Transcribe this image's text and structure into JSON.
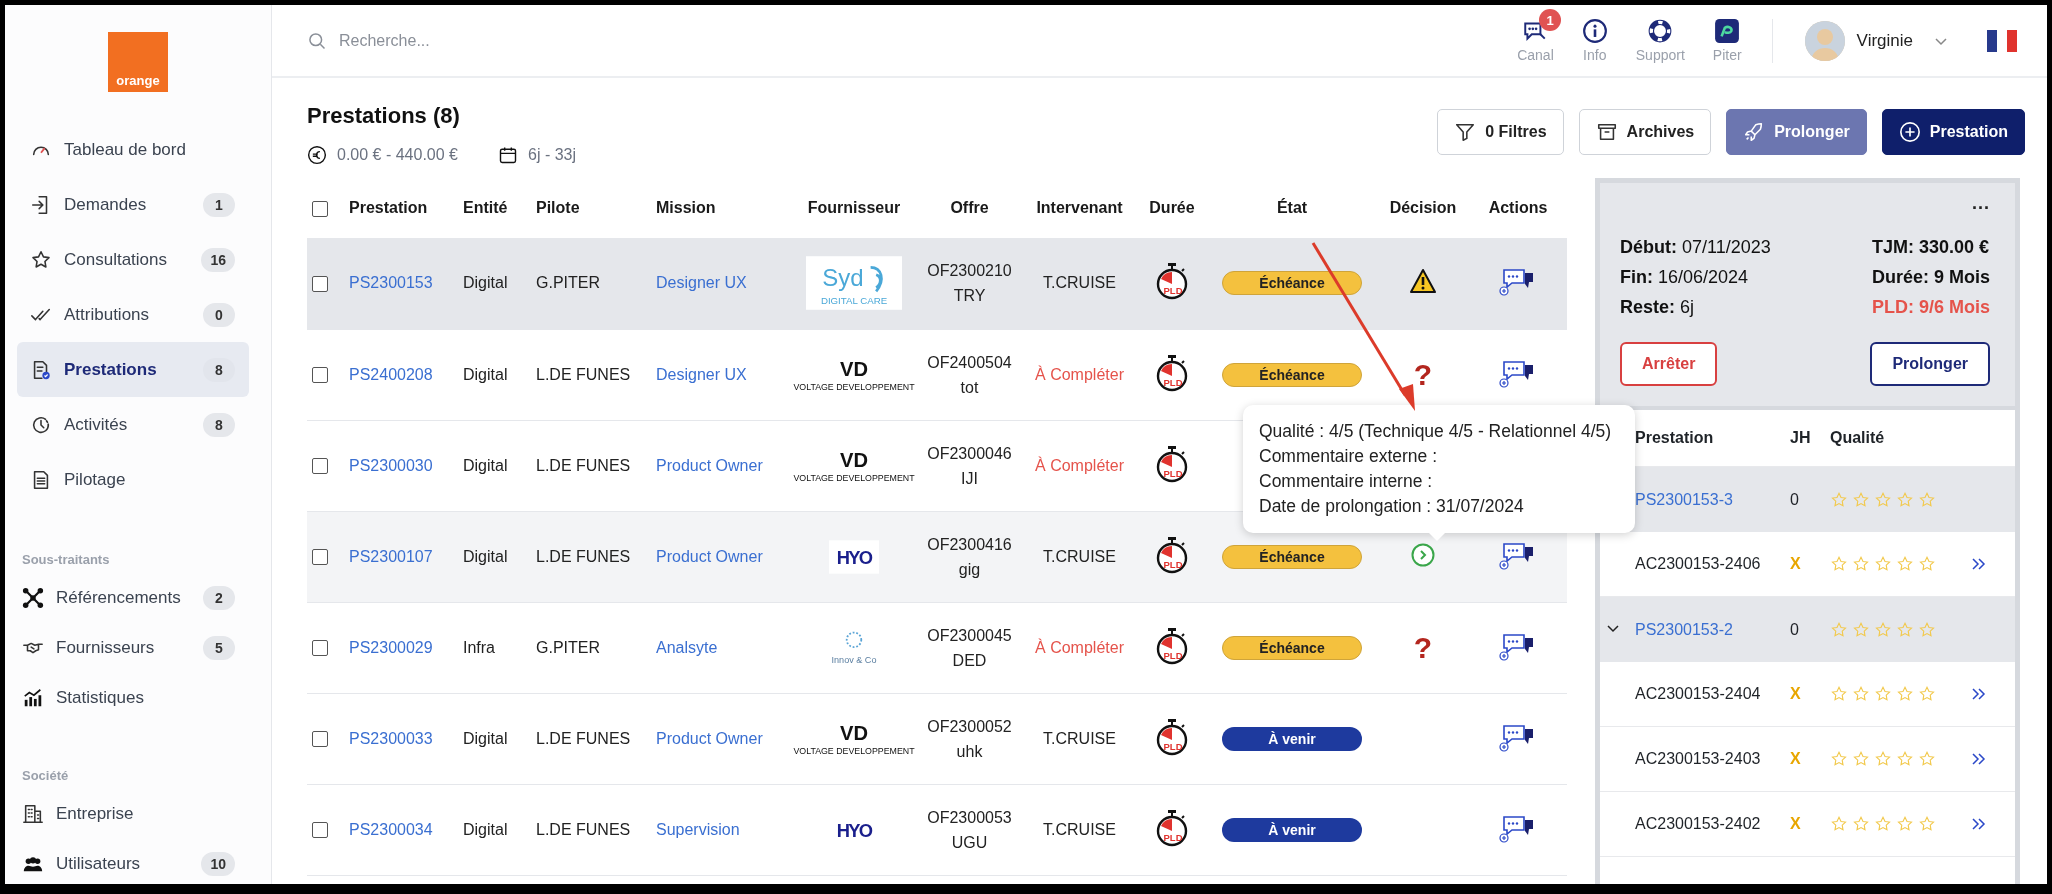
{
  "sidebar": {
    "logo": "orange",
    "sections": [
      {
        "items": [
          {
            "kind": "gauge",
            "label": "Tableau de bord",
            "selected": false
          },
          {
            "kind": "login",
            "label": "Demandes",
            "count": "1",
            "selected": false
          },
          {
            "kind": "star",
            "label": "Consultations",
            "count": "16",
            "selected": false
          },
          {
            "kind": "checks",
            "label": "Attributions",
            "count": "0",
            "selected": false
          },
          {
            "kind": "doccheck",
            "label": "Prestations",
            "count": "8",
            "selected": true
          },
          {
            "kind": "clock",
            "label": "Activités",
            "count": "8",
            "selected": false
          },
          {
            "kind": "doc",
            "label": "Pilotage",
            "selected": false
          }
        ]
      },
      {
        "heading": "Sous-traitants",
        "items": [
          {
            "kind": "network",
            "label": "Référencements",
            "count": "2",
            "selected": false
          },
          {
            "kind": "handshake",
            "label": "Fournisseurs",
            "count": "5",
            "selected": false
          },
          {
            "kind": "chart",
            "label": "Statistiques",
            "selected": false
          }
        ]
      },
      {
        "heading": "Société",
        "items": [
          {
            "kind": "building",
            "label": "Entreprise",
            "selected": false
          },
          {
            "kind": "users",
            "label": "Utilisateurs",
            "count": "10",
            "selected": false
          }
        ]
      }
    ]
  },
  "header": {
    "search": {
      "placeholder": "Recherche..."
    },
    "tools": [
      {
        "kind": "chat",
        "label": "Canal",
        "badge": "1"
      },
      {
        "kind": "info",
        "label": "Info"
      },
      {
        "kind": "lifebuoy",
        "label": "Support"
      },
      {
        "kind": "app",
        "label": "Piter"
      }
    ],
    "user": {
      "name": "Virginie"
    }
  },
  "page": {
    "title": "Prestations (8)",
    "amount_range": "0.00 € - 440.00 €",
    "duration_range": "6j - 33j",
    "buttons": [
      {
        "kind": "filter",
        "label": "0 Filtres",
        "disabled": false
      },
      {
        "kind": "archive",
        "label": "Archives",
        "disabled": false
      },
      {
        "kind": "extend",
        "label": "Prolonger",
        "disabled": true
      },
      {
        "kind": "create",
        "label": "Prestation",
        "disabled": false
      }
    ]
  },
  "table": {
    "all_checked": false,
    "columns": [
      "Prestation",
      "Entité",
      "Pilote",
      "Mission",
      "Fournisseur",
      "Offre",
      "Intervenant",
      "Durée",
      "État",
      "Décision",
      "Actions"
    ],
    "rows": [
      {
        "selected": true,
        "hovered": false,
        "checked": false,
        "id": "PS2300153",
        "entity": "Digital",
        "pilot": "G.PITER",
        "mission": "Designer UX",
        "supplier": {
          "kind": "syd",
          "name": "Syd",
          "tagline": "DIGITAL CARE"
        },
        "offer": "OF2300210\nTRY",
        "actions": true,
        "worker": "T.CRUISE",
        "worker_missing": false,
        "duration": "PLD",
        "status": {
          "kind": "echeance",
          "label": "Échéance"
        },
        "decision": {
          "kind": "warning"
        }
      },
      {
        "selected": false,
        "hovered": false,
        "checked": false,
        "id": "PS2400208",
        "entity": "Digital",
        "pilot": "L.DE FUNES",
        "mission": "Designer UX",
        "supplier": {
          "kind": "voltage",
          "name": "VD",
          "tagline": "VOLTAGE DEVELOPPEMENT"
        },
        "offer": "OF2400504\ntot",
        "actions": true,
        "worker": "À Compléter",
        "worker_missing": true,
        "duration": "PLD",
        "status": {
          "kind": "echeance",
          "label": "Échéance"
        },
        "decision": {
          "kind": "question",
          "text": "?"
        }
      },
      {
        "selected": false,
        "hovered": false,
        "checked": false,
        "id": "PS2300030",
        "entity": "Digital",
        "pilot": "L.DE FUNES",
        "mission": "Product Owner",
        "supplier": {
          "kind": "voltage",
          "name": "VD",
          "tagline": "VOLTAGE DEVELOPPEMENT"
        },
        "offer": "OF2300046\nIJI",
        "worker": "À Compléter",
        "worker_missing": true,
        "duration": "PLD"
      },
      {
        "selected": false,
        "hovered": true,
        "checked": false,
        "id": "PS2300107",
        "entity": "Digital",
        "pilot": "L.DE FUNES",
        "mission": "Product Owner",
        "supplier": {
          "kind": "hyo",
          "name": "HYO"
        },
        "offer": "OF2300416\ngig",
        "actions": true,
        "worker": "T.CRUISE",
        "worker_missing": false,
        "duration": "PLD",
        "status": {
          "kind": "echeance",
          "label": "Échéance"
        },
        "decision": {
          "kind": "next"
        }
      },
      {
        "selected": false,
        "hovered": false,
        "checked": false,
        "id": "PS2300029",
        "entity": "Infra",
        "pilot": "G.PITER",
        "mission": "Analsyte",
        "supplier": {
          "kind": "innov",
          "name": "Innov & Co"
        },
        "offer": "OF2300045\nDED",
        "actions": true,
        "worker": "À Compléter",
        "worker_missing": true,
        "duration": "PLD",
        "status": {
          "kind": "echeance",
          "label": "Échéance"
        },
        "decision": {
          "kind": "question",
          "text": "?"
        }
      },
      {
        "selected": false,
        "hovered": false,
        "checked": false,
        "id": "PS2300033",
        "entity": "Digital",
        "pilot": "L.DE FUNES",
        "mission": "Product Owner",
        "supplier": {
          "kind": "voltage",
          "name": "VD",
          "tagline": "VOLTAGE DEVELOPPEMENT"
        },
        "offer": "OF2300052\nuhk",
        "actions": true,
        "worker": "T.CRUISE",
        "worker_missing": false,
        "duration": "PLD",
        "status": {
          "kind": "avenir",
          "label": "À venir"
        }
      },
      {
        "selected": false,
        "hovered": false,
        "checked": false,
        "id": "PS2300034",
        "entity": "Digital",
        "pilot": "L.DE FUNES",
        "mission": "Supervision",
        "supplier": {
          "kind": "hyo",
          "name": "HYO"
        },
        "offer": "OF2300053\nUGU",
        "actions": true,
        "worker": "T.CRUISE",
        "worker_missing": false,
        "duration": "PLD",
        "status": {
          "kind": "avenir",
          "label": "À venir"
        }
      }
    ]
  },
  "tooltip": {
    "lines": [
      "Qualité :  4/5 (Technique 4/5 - Relationnel 4/5)",
      "Commentaire externe :",
      "Commentaire interne :",
      "Date de prolongation :  31/07/2024"
    ]
  },
  "detail": {
    "menu": "...",
    "left": [
      "**Début:** 07/11/2023",
      "**Fin:** 16/06/2024",
      "**Reste:** 6j"
    ],
    "right": [
      {
        "text": "TJM: 330.00 €",
        "alert": false
      },
      {
        "text": "Durée: 9 Mois",
        "alert": false
      },
      {
        "text": "PLD: 9/6 Mois",
        "alert": true
      }
    ],
    "buttons": [
      {
        "kind": "danger",
        "label": "Arrêter"
      },
      {
        "kind": "primary",
        "label": "Prolonger"
      }
    ],
    "columns": [
      "Prestation",
      "JH",
      "Qualité"
    ],
    "groups": [
      {
        "id": "PS2300153-3",
        "jh": "0",
        "stars": 0,
        "children": [
          {
            "id": "AC2300153-2406",
            "jh": "X",
            "stars": 0
          }
        ]
      },
      {
        "id": "PS2300153-2",
        "jh": "0",
        "stars": 0,
        "expanded": true,
        "children": [
          {
            "id": "AC2300153-2404",
            "jh": "X",
            "stars": 0
          },
          {
            "id": "AC2300153-2403",
            "jh": "X",
            "stars": 0
          },
          {
            "id": "AC2300153-2402",
            "jh": "X",
            "stars": 0
          }
        ]
      }
    ]
  }
}
